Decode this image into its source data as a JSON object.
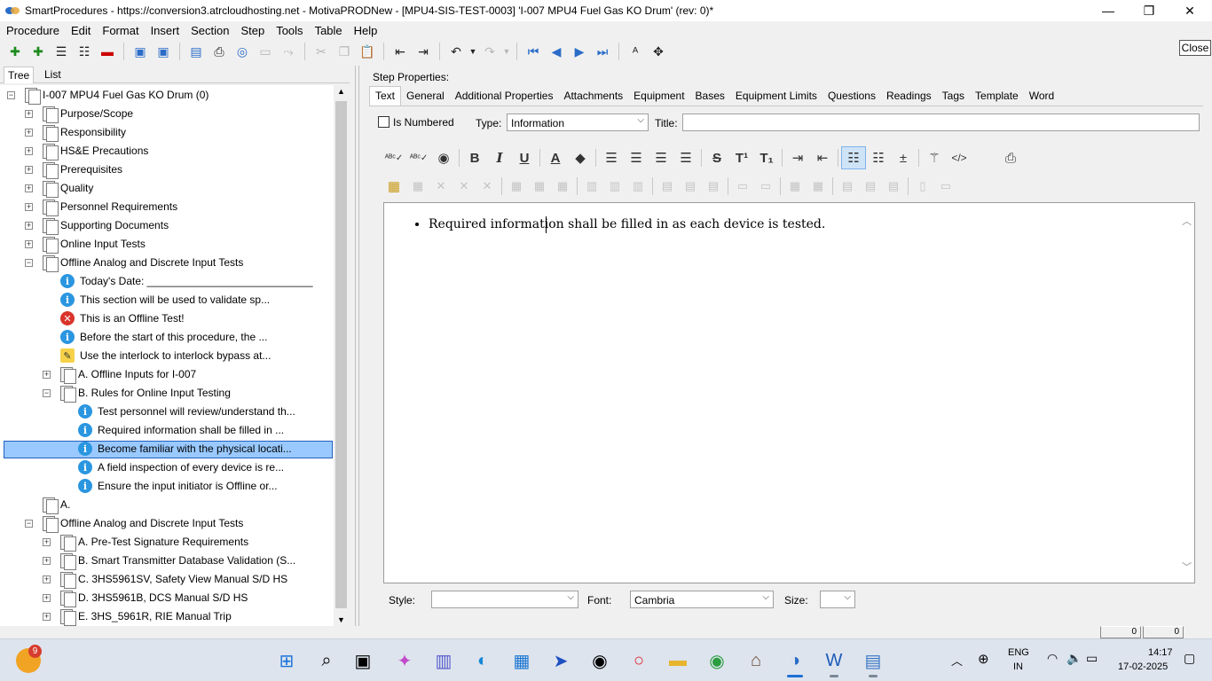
{
  "window": {
    "title": "SmartProcedures - https://conversion3.atrcloudhosting.net - MotivaPRODNew - [MPU4-SIS-TEST-0003] 'I-007 MPU4 Fuel Gas KO Drum' (rev: 0)*",
    "minimize_glyph": "—",
    "maximize_glyph": "❐",
    "close_glyph": "✕"
  },
  "menu": [
    "Procedure",
    "Edit",
    "Format",
    "Insert",
    "Section",
    "Step",
    "Tools",
    "Table",
    "Help"
  ],
  "toolbar": {
    "close_label": "Close"
  },
  "left_tabs": [
    "Tree",
    "List"
  ],
  "tree": [
    {
      "label": "I-007 MPU4 Fuel Gas KO Drum (0)",
      "level": 0,
      "exp": "−",
      "icon": "page"
    },
    {
      "label": "Purpose/Scope",
      "level": 1,
      "exp": "+",
      "icon": "page"
    },
    {
      "label": "Responsibility",
      "level": 1,
      "exp": "+",
      "icon": "page"
    },
    {
      "label": "HS&E Precautions",
      "level": 1,
      "exp": "+",
      "icon": "page"
    },
    {
      "label": "Prerequisites",
      "level": 1,
      "exp": "+",
      "icon": "page"
    },
    {
      "label": "Quality",
      "level": 1,
      "exp": "+",
      "icon": "page"
    },
    {
      "label": "Personnel Requirements",
      "level": 1,
      "exp": "+",
      "icon": "page"
    },
    {
      "label": "Supporting Documents",
      "level": 1,
      "exp": "+",
      "icon": "page"
    },
    {
      "label": "Online Input Tests",
      "level": 1,
      "exp": "+",
      "icon": "page"
    },
    {
      "label": "Offline Analog and Discrete Input Tests",
      "level": 1,
      "exp": "−",
      "icon": "page"
    },
    {
      "label": "Today's Date: ____________________________",
      "level": 2,
      "exp": "",
      "icon": "info"
    },
    {
      "label": "This section will be used to validate sp...",
      "level": 2,
      "exp": "",
      "icon": "info"
    },
    {
      "label": "This is an Offline Test!",
      "level": 2,
      "exp": "",
      "icon": "error"
    },
    {
      "label": "Before the start of this procedure, the ...",
      "level": 2,
      "exp": "",
      "icon": "info"
    },
    {
      "label": "Use the interlock to interlock bypass at...",
      "level": 2,
      "exp": "",
      "icon": "warning"
    },
    {
      "label": "A. Offline Inputs for I-007",
      "level": 2,
      "exp": "+",
      "icon": "page"
    },
    {
      "label": "B. Rules for Online Input Testing",
      "level": 2,
      "exp": "−",
      "icon": "page"
    },
    {
      "label": "Test personnel will review/understand th...",
      "level": 3,
      "exp": "",
      "icon": "info"
    },
    {
      "label": "Required information shall be filled in ...",
      "level": 3,
      "exp": "",
      "icon": "info",
      "selected": true
    },
    {
      "label": "Become familiar with the physical locati...",
      "level": 3,
      "exp": "",
      "icon": "info"
    },
    {
      "label": "A field inspection of every device is re...",
      "level": 3,
      "exp": "",
      "icon": "info"
    },
    {
      "label": "Ensure the input initiator is Offline or...",
      "level": 3,
      "exp": "",
      "icon": "info"
    },
    {
      "label": "A.",
      "level": 1,
      "exp": "",
      "icon": "page"
    },
    {
      "label": "Offline Analog and Discrete Input Tests",
      "level": 1,
      "exp": "−",
      "icon": "page"
    },
    {
      "label": "A. Pre-Test Signature Requirements",
      "level": 2,
      "exp": "+",
      "icon": "page"
    },
    {
      "label": "B. Smart Transmitter Database Validation (S...",
      "level": 2,
      "exp": "+",
      "icon": "page"
    },
    {
      "label": "C. 3HS5961SV, Safety View Manual S/D HS",
      "level": 2,
      "exp": "+",
      "icon": "page"
    },
    {
      "label": "D. 3HS5961B, DCS Manual S/D HS",
      "level": 2,
      "exp": "+",
      "icon": "page"
    },
    {
      "label": "E. 3HS_5961R, RIE Manual Trip",
      "level": 2,
      "exp": "+",
      "icon": "page"
    }
  ],
  "step_properties": {
    "header": "Step Properties:",
    "tabs": [
      "Text",
      "General",
      "Additional Properties",
      "Attachments",
      "Equipment",
      "Bases",
      "Equipment Limits",
      "Questions",
      "Readings",
      "Tags",
      "Template",
      "Word"
    ],
    "active_tab": "Text",
    "is_numbered_label": "Is Numbered",
    "type_label": "Type:",
    "type_value": "Information",
    "title_label": "Title:",
    "title_value": "",
    "editor_text": "Required information shall be filled in as each device is tested.",
    "style_label": "Style:",
    "style_value": "",
    "font_label": "Font:",
    "font_value": "Cambria",
    "size_label": "Size:",
    "size_value": ""
  },
  "status": [
    "0",
    "0"
  ],
  "tray": {
    "lang": "ENG",
    "region": "IN",
    "time": "14:17",
    "date": "17-02-2025",
    "weather_badge": "9"
  },
  "colors": {
    "selection": "#99c9ff",
    "accent": "#2a6cc8",
    "info_icon": "#2a96e0",
    "error_icon": "#d9342b"
  }
}
